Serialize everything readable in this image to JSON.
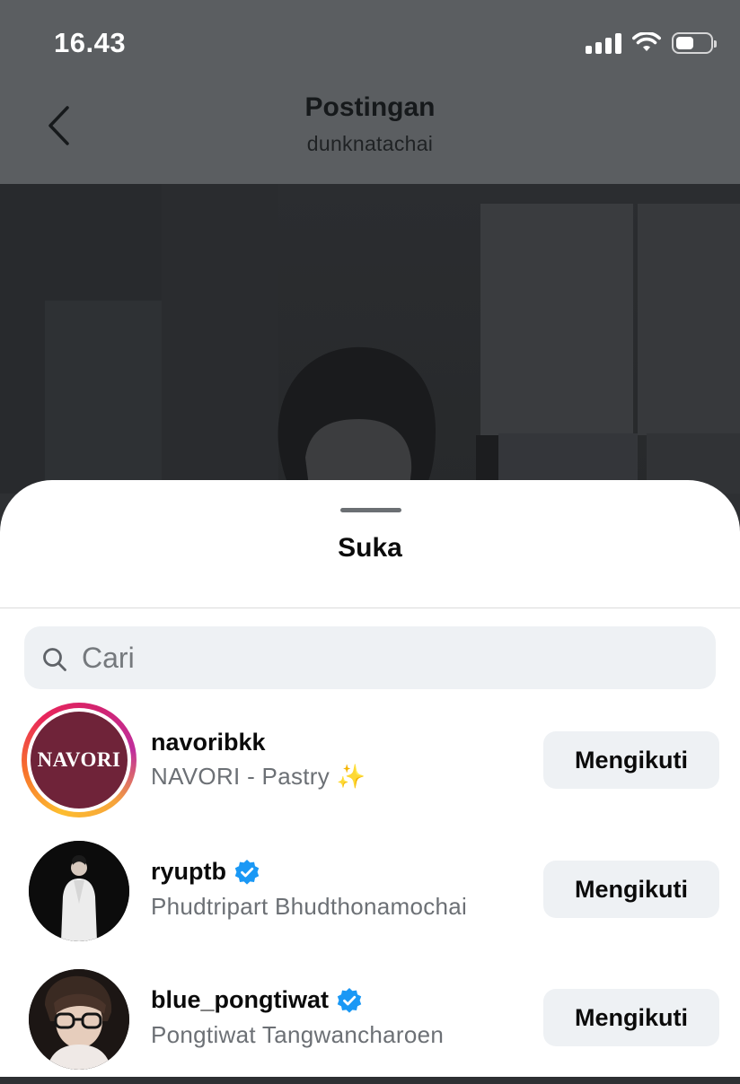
{
  "status_bar": {
    "time": "16.43",
    "icons": [
      "cellular-signal-icon",
      "wifi-icon",
      "battery-icon"
    ]
  },
  "nav": {
    "title": "Postingan",
    "subtitle": "dunknatachai",
    "back_icon": "chevron-left-icon"
  },
  "sheet": {
    "title": "Suka"
  },
  "search": {
    "placeholder": "Cari",
    "value": ""
  },
  "users": [
    {
      "username": "navoribkk",
      "fullname": "NAVORI - Pastry ✨",
      "verified": false,
      "has_story": true,
      "avatar_text": "NAVORI",
      "avatar_color": "#6f2339",
      "button": "Mengikuti"
    },
    {
      "username": "ryuptb",
      "fullname": "Phudtripart Bhudthonamochai",
      "verified": true,
      "has_story": false,
      "button": "Mengikuti"
    },
    {
      "username": "blue_pongtiwat",
      "fullname": "Pongtiwat Tangwancharoen",
      "verified": true,
      "has_story": false,
      "button": "Mengikuti"
    }
  ],
  "colors": {
    "verified": "#1a98f5",
    "button_bg": "#eef1f4",
    "dim_overlay": "#5b5e61"
  }
}
